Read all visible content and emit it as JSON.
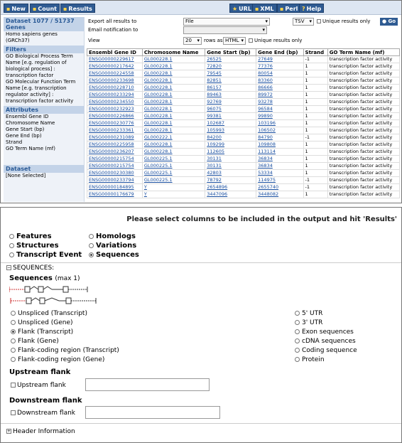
{
  "toolbar": {
    "new": "New",
    "count": "Count",
    "results": "Results",
    "url": "URL",
    "xml": "XML",
    "perl": "Perl",
    "help": "Help"
  },
  "sidebar": {
    "dataset_header": "Dataset 1077 / 51737 Genes",
    "dataset_name": "Homo sapiens genes (GRCh37)",
    "filters_header": "Filters",
    "filters": [
      "GO Biological Process Term Name [e.g. regulation of biological process] : transcription factor",
      "GO Molecular Function Term Name [e.g. transcription regulator activity] : transcription factor activity"
    ],
    "attributes_header": "Attributes",
    "attributes": [
      "Ensembl Gene ID",
      "Chromosome Name",
      "Gene Start (bp)",
      "Gene End (bp)",
      "Strand",
      "GO Term Name (mf)"
    ],
    "dataset2_header": "Dataset",
    "dataset2_value": "[None Selected]"
  },
  "export": {
    "export_label": "Export  all results to",
    "export_value": "File",
    "format_value": "TSV",
    "unique_label": "Unique results only",
    "go_label": "Go",
    "email_label": "Email notification to",
    "view_label": "View",
    "view_count": "20",
    "rows_as": "rows as",
    "view_format": "HTML",
    "unique_label2": "Unique results only"
  },
  "results_table": {
    "headers": [
      "Ensembl Gene ID",
      "Chromosome Name",
      "Gene Start (bp)",
      "Gene End (bp)",
      "Strand",
      "GO Term Name (mf)"
    ],
    "rows": [
      [
        "ENSG00000229617",
        "GL000228.1",
        "26525",
        "27649",
        "-1",
        "transcription factor activity"
      ],
      [
        "ENSG00000217642",
        "GL000228.1",
        "72820",
        "77376",
        "1",
        "transcription factor activity"
      ],
      [
        "ENSG00000224558",
        "GL000228.1",
        "79545",
        "80054",
        "1",
        "transcription factor activity"
      ],
      [
        "ENSG00000233698",
        "GL000228.1",
        "82851",
        "83360",
        "1",
        "transcription factor activity"
      ],
      [
        "ENSG00000228710",
        "GL000228.1",
        "86157",
        "86666",
        "1",
        "transcription factor activity"
      ],
      [
        "ENSG00000233294",
        "GL000228.1",
        "89463",
        "89972",
        "1",
        "transcription factor activity"
      ],
      [
        "ENSG00000234550",
        "GL000228.1",
        "92769",
        "93278",
        "1",
        "transcription factor activity"
      ],
      [
        "ENSG00000232923",
        "GL000228.1",
        "96075",
        "96584",
        "1",
        "transcription factor activity"
      ],
      [
        "ENSG00000226866",
        "GL000228.1",
        "99381",
        "99890",
        "1",
        "transcription factor activity"
      ],
      [
        "ENSG00000230776",
        "GL000228.1",
        "102687",
        "103196",
        "1",
        "transcription factor activity"
      ],
      [
        "ENSG00000233361",
        "GL000228.1",
        "105993",
        "106502",
        "1",
        "transcription factor activity"
      ],
      [
        "ENSG00000231089",
        "GL000222.1",
        "84200",
        "84790",
        "-1",
        "transcription factor activity"
      ],
      [
        "ENSG00000225958",
        "GL000228.1",
        "109299",
        "109808",
        "1",
        "transcription factor activity"
      ],
      [
        "ENSG00000236207",
        "GL000228.1",
        "112605",
        "113114",
        "1",
        "transcription factor activity"
      ],
      [
        "ENSG00000215754",
        "GL000225.1",
        "30131",
        "36834",
        "1",
        "transcription factor activity"
      ],
      [
        "ENSG00000215754",
        "GL000225.1",
        "30131",
        "36834",
        "1",
        "transcription factor activity"
      ],
      [
        "ENSG00000230380",
        "GL000225.1",
        "42803",
        "53334",
        "1",
        "transcription factor activity"
      ],
      [
        "ENSG00000233794",
        "GL000225.1",
        "78792",
        "114975",
        "-1",
        "transcription factor activity"
      ],
      [
        "ENSG00000184895",
        "Y",
        "2654896",
        "2655740",
        "-1",
        "transcription factor activity"
      ],
      [
        "ENSG00000176679",
        "Y",
        "3447096",
        "3448082",
        "1",
        "transcription factor activity"
      ]
    ]
  },
  "panel2": {
    "instruction": "Please select columns to be included in the output and hit 'Results'",
    "page_options": [
      {
        "label": "Features",
        "selected": false
      },
      {
        "label": "Homologs",
        "selected": false
      },
      {
        "label": "Structures",
        "selected": false
      },
      {
        "label": "Variations",
        "selected": false
      },
      {
        "label": "Transcript Event",
        "selected": false
      },
      {
        "label": "Sequences",
        "selected": true
      }
    ],
    "sequences_section": "SEQUENCES:",
    "sequences_title": "Sequences",
    "sequences_max": "(max 1)",
    "left_options": [
      {
        "label": "Unspliced (Transcript)",
        "selected": false
      },
      {
        "label": "Unspliced (Gene)",
        "selected": false
      },
      {
        "label": "Flank (Transcript)",
        "selected": true
      },
      {
        "label": "Flank (Gene)",
        "selected": false
      },
      {
        "label": "Flank-coding region (Transcript)",
        "selected": false
      },
      {
        "label": "Flank-coding region (Gene)",
        "selected": false
      }
    ],
    "right_options": [
      {
        "label": "5' UTR",
        "selected": false
      },
      {
        "label": "3' UTR",
        "selected": false
      },
      {
        "label": "Exon sequences",
        "selected": false
      },
      {
        "label": "cDNA sequences",
        "selected": false
      },
      {
        "label": "Coding sequence",
        "selected": false
      },
      {
        "label": "Protein",
        "selected": false
      }
    ],
    "upstream_title": "Upstream flank",
    "upstream_label": "Upstream flank",
    "downstream_title": "Downstream flank",
    "downstream_label": "Downstream flank",
    "header_info": "Header Information"
  }
}
